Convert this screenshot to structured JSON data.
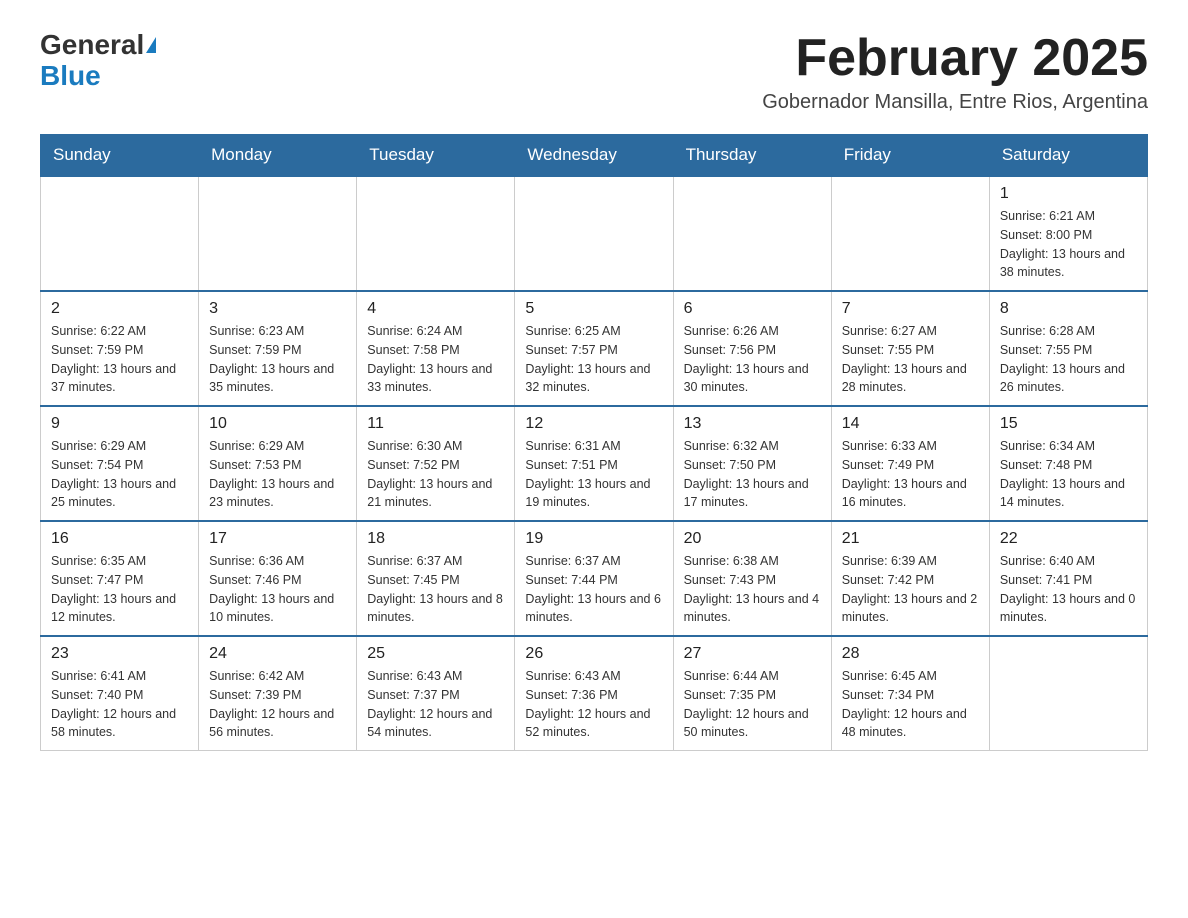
{
  "logo": {
    "general": "General",
    "blue": "Blue"
  },
  "title": {
    "month": "February 2025",
    "location": "Gobernador Mansilla, Entre Rios, Argentina"
  },
  "days_of_week": [
    "Sunday",
    "Monday",
    "Tuesday",
    "Wednesday",
    "Thursday",
    "Friday",
    "Saturday"
  ],
  "weeks": [
    [
      {
        "day": "",
        "sunrise": "",
        "sunset": "",
        "daylight": ""
      },
      {
        "day": "",
        "sunrise": "",
        "sunset": "",
        "daylight": ""
      },
      {
        "day": "",
        "sunrise": "",
        "sunset": "",
        "daylight": ""
      },
      {
        "day": "",
        "sunrise": "",
        "sunset": "",
        "daylight": ""
      },
      {
        "day": "",
        "sunrise": "",
        "sunset": "",
        "daylight": ""
      },
      {
        "day": "",
        "sunrise": "",
        "sunset": "",
        "daylight": ""
      },
      {
        "day": "1",
        "sunrise": "Sunrise: 6:21 AM",
        "sunset": "Sunset: 8:00 PM",
        "daylight": "Daylight: 13 hours and 38 minutes."
      }
    ],
    [
      {
        "day": "2",
        "sunrise": "Sunrise: 6:22 AM",
        "sunset": "Sunset: 7:59 PM",
        "daylight": "Daylight: 13 hours and 37 minutes."
      },
      {
        "day": "3",
        "sunrise": "Sunrise: 6:23 AM",
        "sunset": "Sunset: 7:59 PM",
        "daylight": "Daylight: 13 hours and 35 minutes."
      },
      {
        "day": "4",
        "sunrise": "Sunrise: 6:24 AM",
        "sunset": "Sunset: 7:58 PM",
        "daylight": "Daylight: 13 hours and 33 minutes."
      },
      {
        "day": "5",
        "sunrise": "Sunrise: 6:25 AM",
        "sunset": "Sunset: 7:57 PM",
        "daylight": "Daylight: 13 hours and 32 minutes."
      },
      {
        "day": "6",
        "sunrise": "Sunrise: 6:26 AM",
        "sunset": "Sunset: 7:56 PM",
        "daylight": "Daylight: 13 hours and 30 minutes."
      },
      {
        "day": "7",
        "sunrise": "Sunrise: 6:27 AM",
        "sunset": "Sunset: 7:55 PM",
        "daylight": "Daylight: 13 hours and 28 minutes."
      },
      {
        "day": "8",
        "sunrise": "Sunrise: 6:28 AM",
        "sunset": "Sunset: 7:55 PM",
        "daylight": "Daylight: 13 hours and 26 minutes."
      }
    ],
    [
      {
        "day": "9",
        "sunrise": "Sunrise: 6:29 AM",
        "sunset": "Sunset: 7:54 PM",
        "daylight": "Daylight: 13 hours and 25 minutes."
      },
      {
        "day": "10",
        "sunrise": "Sunrise: 6:29 AM",
        "sunset": "Sunset: 7:53 PM",
        "daylight": "Daylight: 13 hours and 23 minutes."
      },
      {
        "day": "11",
        "sunrise": "Sunrise: 6:30 AM",
        "sunset": "Sunset: 7:52 PM",
        "daylight": "Daylight: 13 hours and 21 minutes."
      },
      {
        "day": "12",
        "sunrise": "Sunrise: 6:31 AM",
        "sunset": "Sunset: 7:51 PM",
        "daylight": "Daylight: 13 hours and 19 minutes."
      },
      {
        "day": "13",
        "sunrise": "Sunrise: 6:32 AM",
        "sunset": "Sunset: 7:50 PM",
        "daylight": "Daylight: 13 hours and 17 minutes."
      },
      {
        "day": "14",
        "sunrise": "Sunrise: 6:33 AM",
        "sunset": "Sunset: 7:49 PM",
        "daylight": "Daylight: 13 hours and 16 minutes."
      },
      {
        "day": "15",
        "sunrise": "Sunrise: 6:34 AM",
        "sunset": "Sunset: 7:48 PM",
        "daylight": "Daylight: 13 hours and 14 minutes."
      }
    ],
    [
      {
        "day": "16",
        "sunrise": "Sunrise: 6:35 AM",
        "sunset": "Sunset: 7:47 PM",
        "daylight": "Daylight: 13 hours and 12 minutes."
      },
      {
        "day": "17",
        "sunrise": "Sunrise: 6:36 AM",
        "sunset": "Sunset: 7:46 PM",
        "daylight": "Daylight: 13 hours and 10 minutes."
      },
      {
        "day": "18",
        "sunrise": "Sunrise: 6:37 AM",
        "sunset": "Sunset: 7:45 PM",
        "daylight": "Daylight: 13 hours and 8 minutes."
      },
      {
        "day": "19",
        "sunrise": "Sunrise: 6:37 AM",
        "sunset": "Sunset: 7:44 PM",
        "daylight": "Daylight: 13 hours and 6 minutes."
      },
      {
        "day": "20",
        "sunrise": "Sunrise: 6:38 AM",
        "sunset": "Sunset: 7:43 PM",
        "daylight": "Daylight: 13 hours and 4 minutes."
      },
      {
        "day": "21",
        "sunrise": "Sunrise: 6:39 AM",
        "sunset": "Sunset: 7:42 PM",
        "daylight": "Daylight: 13 hours and 2 minutes."
      },
      {
        "day": "22",
        "sunrise": "Sunrise: 6:40 AM",
        "sunset": "Sunset: 7:41 PM",
        "daylight": "Daylight: 13 hours and 0 minutes."
      }
    ],
    [
      {
        "day": "23",
        "sunrise": "Sunrise: 6:41 AM",
        "sunset": "Sunset: 7:40 PM",
        "daylight": "Daylight: 12 hours and 58 minutes."
      },
      {
        "day": "24",
        "sunrise": "Sunrise: 6:42 AM",
        "sunset": "Sunset: 7:39 PM",
        "daylight": "Daylight: 12 hours and 56 minutes."
      },
      {
        "day": "25",
        "sunrise": "Sunrise: 6:43 AM",
        "sunset": "Sunset: 7:37 PM",
        "daylight": "Daylight: 12 hours and 54 minutes."
      },
      {
        "day": "26",
        "sunrise": "Sunrise: 6:43 AM",
        "sunset": "Sunset: 7:36 PM",
        "daylight": "Daylight: 12 hours and 52 minutes."
      },
      {
        "day": "27",
        "sunrise": "Sunrise: 6:44 AM",
        "sunset": "Sunset: 7:35 PM",
        "daylight": "Daylight: 12 hours and 50 minutes."
      },
      {
        "day": "28",
        "sunrise": "Sunrise: 6:45 AM",
        "sunset": "Sunset: 7:34 PM",
        "daylight": "Daylight: 12 hours and 48 minutes."
      },
      {
        "day": "",
        "sunrise": "",
        "sunset": "",
        "daylight": ""
      }
    ]
  ]
}
